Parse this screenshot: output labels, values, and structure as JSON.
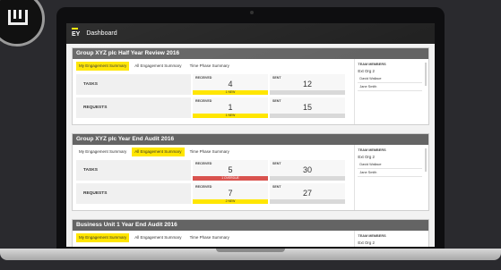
{
  "app": {
    "title": "Dashboard",
    "logo_text": "EY"
  },
  "panels": [
    {
      "title": "Group XYZ plc Half Year Review 2016",
      "tabs": [
        {
          "label": "My Engagement Summary",
          "active": true
        },
        {
          "label": "All Engagement Summary",
          "active": false
        },
        {
          "label": "Time Phase Summary",
          "active": false
        }
      ],
      "rows": [
        {
          "label": "TASKS",
          "received": {
            "label": "RECEIVED",
            "value": "4",
            "badge": "1 NEW",
            "badge_color": "yellow"
          },
          "sent": {
            "label": "SENT",
            "value": "12"
          }
        },
        {
          "label": "REQUESTS",
          "received": {
            "label": "RECEIVED",
            "value": "1",
            "badge": "1 NEW",
            "badge_color": "yellow"
          },
          "sent": {
            "label": "SENT",
            "value": "15"
          }
        }
      ],
      "team": {
        "title": "TEAM MEMBERS",
        "ext": "Ext Org 2",
        "members": [
          "David Wallace",
          "Jane Smith"
        ]
      }
    },
    {
      "title": "Group XYZ plc Year End Audit 2016",
      "tabs": [
        {
          "label": "My Engagement Summary",
          "active": false
        },
        {
          "label": "All Engagement Summary",
          "active": true
        },
        {
          "label": "Time Phase Summary",
          "active": false
        }
      ],
      "rows": [
        {
          "label": "TASKS",
          "received": {
            "label": "RECEIVED",
            "value": "5",
            "badge": "1 OVERDUE",
            "badge_color": "red"
          },
          "sent": {
            "label": "SENT",
            "value": "30"
          }
        },
        {
          "label": "REQUESTS",
          "received": {
            "label": "RECEIVED",
            "value": "7",
            "badge": "2 NEW",
            "badge_color": "yellow"
          },
          "sent": {
            "label": "SENT",
            "value": "27"
          }
        }
      ],
      "team": {
        "title": "TEAM MEMBERS",
        "ext": "Ext Org 2",
        "members": [
          "David Wallace",
          "Jane Smith"
        ]
      }
    },
    {
      "title": "Business Unit 1 Year End Audit 2016",
      "tabs": [
        {
          "label": "My Engagement Summary",
          "active": true
        },
        {
          "label": "All Engagement Summary",
          "active": false
        },
        {
          "label": "Time Phase Summary",
          "active": false
        }
      ],
      "team": {
        "title": "TEAM MEMBERS",
        "ext": "Ext Org 2"
      }
    }
  ],
  "colors": {
    "accent": "#ffe600",
    "header": "#646464",
    "overdue": "#d9534f",
    "topbar": "#222222"
  }
}
